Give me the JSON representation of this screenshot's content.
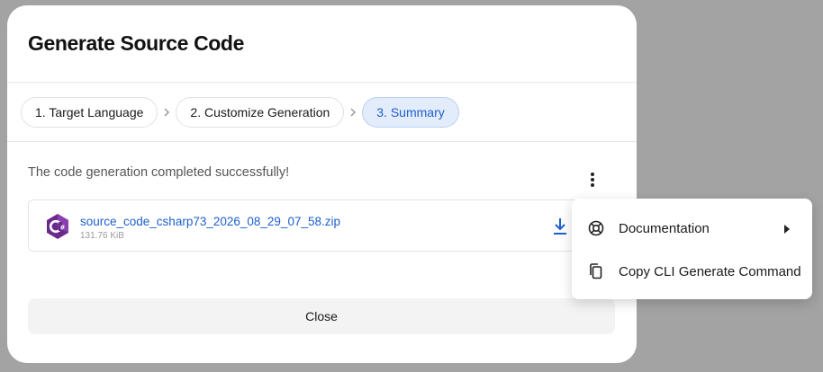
{
  "dialog": {
    "title": "Generate Source Code",
    "steps": [
      {
        "label": "1. Target Language"
      },
      {
        "label": "2. Customize Generation"
      },
      {
        "label": "3. Summary"
      }
    ],
    "status_text": "The code generation completed successfully!",
    "file": {
      "name": "source_code_csharp73_2026_08_29_07_58.zip",
      "size": "131.76 KiB",
      "icon": "csharp-icon"
    },
    "close_label": "Close"
  },
  "menu": {
    "items": [
      {
        "label": "Documentation",
        "icon": "lifebuoy-icon",
        "has_submenu": true
      },
      {
        "label": "Copy CLI Generate Command",
        "icon": "copy-icon",
        "has_submenu": false
      }
    ]
  },
  "colors": {
    "accent": "#1d5fcf",
    "active_step_bg": "#e3ecfa",
    "backdrop": "#a3a3a3",
    "csharp_purple": "#6a2a8c"
  }
}
